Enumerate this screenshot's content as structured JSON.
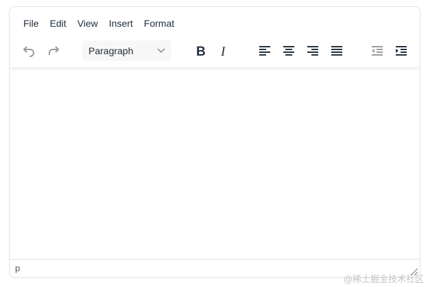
{
  "menubar": {
    "items": [
      "File",
      "Edit",
      "View",
      "Insert",
      "Format"
    ]
  },
  "toolbar": {
    "block_format": "Paragraph"
  },
  "statusbar": {
    "path": "p"
  },
  "watermark": "@稀土掘金技术社区",
  "colors": {
    "icon": "#222f3e",
    "disabled": "#9a9a9a"
  }
}
